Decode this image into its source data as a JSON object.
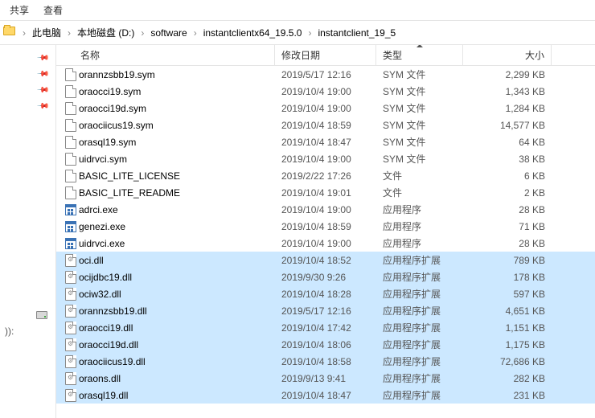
{
  "toolbar": {
    "share": "共享",
    "view": "查看"
  },
  "breadcrumbs": [
    {
      "label": "此电脑",
      "icon": "pc"
    },
    {
      "label": "本地磁盘 (D:)",
      "icon": null
    },
    {
      "label": "software",
      "icon": null
    },
    {
      "label": "instantclientx64_19.5.0",
      "icon": null
    },
    {
      "label": "instantclient_19_5",
      "icon": null
    }
  ],
  "sidebar_pins": [
    "",
    "",
    "",
    ""
  ],
  "sidebar_drive": ")):",
  "columns": {
    "name": "名称",
    "date": "修改日期",
    "type": "类型",
    "size": "大小",
    "sort_col": "type",
    "sort_dir": "asc"
  },
  "files": [
    {
      "icon": "file",
      "name": "orannzsbb19.sym",
      "date": "2019/5/17 12:16",
      "type": "SYM 文件",
      "size": "2,299 KB",
      "selected": false
    },
    {
      "icon": "file",
      "name": "oraocci19.sym",
      "date": "2019/10/4 19:00",
      "type": "SYM 文件",
      "size": "1,343 KB",
      "selected": false
    },
    {
      "icon": "file",
      "name": "oraocci19d.sym",
      "date": "2019/10/4 19:00",
      "type": "SYM 文件",
      "size": "1,284 KB",
      "selected": false
    },
    {
      "icon": "file",
      "name": "oraociicus19.sym",
      "date": "2019/10/4 18:59",
      "type": "SYM 文件",
      "size": "14,577 KB",
      "selected": false
    },
    {
      "icon": "file",
      "name": "orasql19.sym",
      "date": "2019/10/4 18:47",
      "type": "SYM 文件",
      "size": "64 KB",
      "selected": false
    },
    {
      "icon": "file",
      "name": "uidrvci.sym",
      "date": "2019/10/4 19:00",
      "type": "SYM 文件",
      "size": "38 KB",
      "selected": false
    },
    {
      "icon": "file",
      "name": "BASIC_LITE_LICENSE",
      "date": "2019/2/22 17:26",
      "type": "文件",
      "size": "6 KB",
      "selected": false
    },
    {
      "icon": "file",
      "name": "BASIC_LITE_README",
      "date": "2019/10/4 19:01",
      "type": "文件",
      "size": "2 KB",
      "selected": false
    },
    {
      "icon": "exe",
      "name": "adrci.exe",
      "date": "2019/10/4 19:00",
      "type": "应用程序",
      "size": "28 KB",
      "selected": false
    },
    {
      "icon": "exe",
      "name": "genezi.exe",
      "date": "2019/10/4 18:59",
      "type": "应用程序",
      "size": "71 KB",
      "selected": false
    },
    {
      "icon": "exe",
      "name": "uidrvci.exe",
      "date": "2019/10/4 19:00",
      "type": "应用程序",
      "size": "28 KB",
      "selected": false
    },
    {
      "icon": "dll",
      "name": "oci.dll",
      "date": "2019/10/4 18:52",
      "type": "应用程序扩展",
      "size": "789 KB",
      "selected": true
    },
    {
      "icon": "dll",
      "name": "ocijdbc19.dll",
      "date": "2019/9/30 9:26",
      "type": "应用程序扩展",
      "size": "178 KB",
      "selected": true
    },
    {
      "icon": "dll",
      "name": "ociw32.dll",
      "date": "2019/10/4 18:28",
      "type": "应用程序扩展",
      "size": "597 KB",
      "selected": true
    },
    {
      "icon": "dll",
      "name": "orannzsbb19.dll",
      "date": "2019/5/17 12:16",
      "type": "应用程序扩展",
      "size": "4,651 KB",
      "selected": true
    },
    {
      "icon": "dll",
      "name": "oraocci19.dll",
      "date": "2019/10/4 17:42",
      "type": "应用程序扩展",
      "size": "1,151 KB",
      "selected": true
    },
    {
      "icon": "dll",
      "name": "oraocci19d.dll",
      "date": "2019/10/4 18:06",
      "type": "应用程序扩展",
      "size": "1,175 KB",
      "selected": true
    },
    {
      "icon": "dll",
      "name": "oraociicus19.dll",
      "date": "2019/10/4 18:58",
      "type": "应用程序扩展",
      "size": "72,686 KB",
      "selected": true
    },
    {
      "icon": "dll",
      "name": "oraons.dll",
      "date": "2019/9/13 9:41",
      "type": "应用程序扩展",
      "size": "282 KB",
      "selected": true
    },
    {
      "icon": "dll",
      "name": "orasql19.dll",
      "date": "2019/10/4 18:47",
      "type": "应用程序扩展",
      "size": "231 KB",
      "selected": true
    }
  ]
}
